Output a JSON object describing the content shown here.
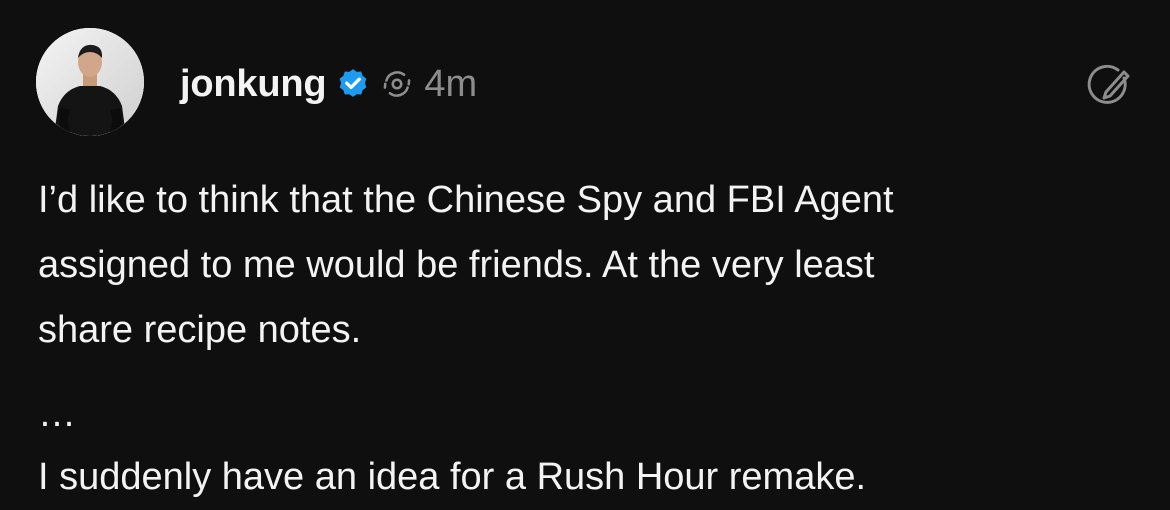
{
  "post": {
    "author": "jonkung",
    "timestamp": "4m",
    "icons": {
      "verified": "verified-badge-icon",
      "ai": "ai-label-icon",
      "more": "compose-edit-icon"
    },
    "colors": {
      "background": "#0f0f0f",
      "text": "#f3f3f3",
      "muted": "#8d8d8d",
      "verified_blue": "#1d9bf0"
    },
    "lines": [
      "I’d like to think that the Chinese Spy and FBI Agent",
      "assigned to me would be friends. At the very least",
      "share recipe notes."
    ],
    "ellipsis": "…",
    "closing": "I suddenly have an idea for a Rush Hour remake."
  }
}
